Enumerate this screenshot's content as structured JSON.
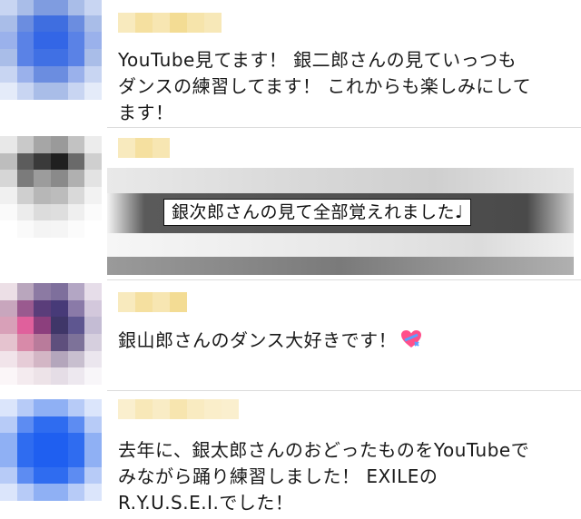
{
  "comments": [
    {
      "avatar": [
        "#c8d5f2",
        "#a9bde8",
        "#7f9ce0",
        "#7f9ce0",
        "#a9bde8",
        "#c8d5f2",
        "#a9bde8",
        "#6b8de0",
        "#3f6ee0",
        "#3f6ee0",
        "#6b8de0",
        "#a9bde8",
        "#9ab1eb",
        "#5a82e6",
        "#3366e6",
        "#3366e6",
        "#5a82e6",
        "#9ab1eb",
        "#a9bde8",
        "#5a82e6",
        "#4070e4",
        "#4070e4",
        "#5a82e6",
        "#a9bde8",
        "#c8d5f2",
        "#9ab1eb",
        "#6b8de0",
        "#6b8de0",
        "#9ab1eb",
        "#c8d5f2",
        "#e4ebf9",
        "#c8d5f2",
        "#a9bde8",
        "#a9bde8",
        "#c8d5f2",
        "#e4ebf9"
      ],
      "username_color": "#f2d888",
      "text": "YouTube見てます！ 銀二郎さんの見ていっつも\nダンスの練習してます！ これからも楽しみにして\nます！"
    },
    {
      "avatar": [
        "#e8e8e8",
        "#c9c9c9",
        "#a6a6a6",
        "#9a9a9a",
        "#c2c2c2",
        "#ececec",
        "#bdbdbd",
        "#5c5c5c",
        "#3a3a3a",
        "#202020",
        "#6a6a6a",
        "#cfcfcf",
        "#d6d6d6",
        "#7b7b7b",
        "#9c9c9c",
        "#8a8a8a",
        "#b0b0b0",
        "#e3e3e3",
        "#f0f0f0",
        "#cfcfcf",
        "#b7b7b7",
        "#bcbcbc",
        "#d9d9d9",
        "#f2f2f2",
        "#fafafa",
        "#ececec",
        "#dcdcdc",
        "#dedede",
        "#efefef",
        "#fbfbfb",
        "#ffffff",
        "#fafafa",
        "#f4f4f4",
        "#f5f5f5",
        "#fbfbfb",
        "#ffffff"
      ],
      "username_color": "#f2d888",
      "caption": "銀次郎さんの見て全部覚えれました♩"
    },
    {
      "avatar": [
        "#ecdfe6",
        "#b9a6bd",
        "#8c7aa3",
        "#7e6f9c",
        "#b3a6c4",
        "#e6dde9",
        "#c8a6bd",
        "#9a5a8f",
        "#5a3d7a",
        "#473a78",
        "#8a7aa8",
        "#d3c8dc",
        "#d8a0b8",
        "#e0609c",
        "#8c3f7d",
        "#3f3668",
        "#5e5690",
        "#c4bcd4",
        "#e5c3cf",
        "#d88aa9",
        "#b97b9b",
        "#5e4f7d",
        "#7d7299",
        "#d6cfde",
        "#f1e4ea",
        "#e6ccd7",
        "#d3b6c5",
        "#b4a6bc",
        "#c8bfcf",
        "#ebe6ee",
        "#fbf6f8",
        "#f4ebef",
        "#ede3e8",
        "#e5dde6",
        "#ede8ef",
        "#f8f6f9"
      ],
      "username_color": "#f2d888",
      "text": "銀山郎さんのダンス大好きです！",
      "emoji": "heart-with-ribbon"
    },
    {
      "avatar": [
        "#dbe5fb",
        "#b7cbf7",
        "#8fb0f4",
        "#8fb0f4",
        "#b7cbf7",
        "#dbe5fb",
        "#b7cbf7",
        "#5d8cf2",
        "#2f6cf0",
        "#2f6cf0",
        "#5d8cf2",
        "#b7cbf7",
        "#8fb0f4",
        "#2f6cf0",
        "#1f5ff0",
        "#1f5ff0",
        "#2f6cf0",
        "#8fb0f4",
        "#8fb0f4",
        "#2f6cf0",
        "#1f5ff0",
        "#1f5ff0",
        "#2f6cf0",
        "#8fb0f4",
        "#b7cbf7",
        "#5d8cf2",
        "#2f6cf0",
        "#2f6cf0",
        "#5d8cf2",
        "#b7cbf7",
        "#dbe5fb",
        "#b7cbf7",
        "#8fb0f4",
        "#8fb0f4",
        "#b7cbf7",
        "#dbe5fb"
      ],
      "username_color": "#f6e2a6",
      "text": "去年に、銀太郎さんのおどったものをYouTubeで\nみながら踊り練習しました！ EXILEの\nR.Y.U.S.E.I.でした！"
    }
  ]
}
